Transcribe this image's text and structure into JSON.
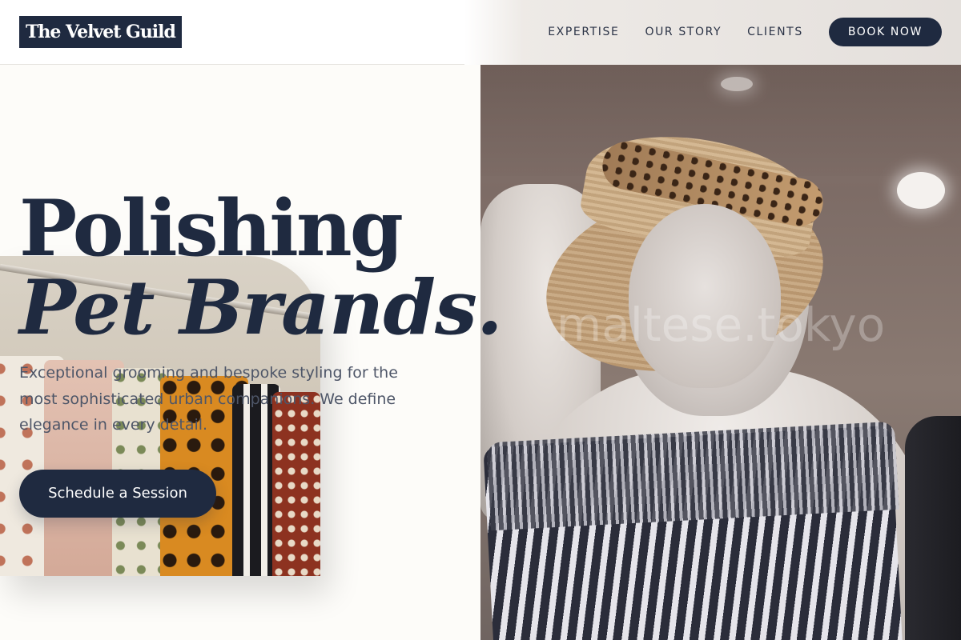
{
  "brand": {
    "logo_text": "The Velvet Guild"
  },
  "nav": {
    "items": [
      {
        "label": "EXPERTISE"
      },
      {
        "label": "OUR STORY"
      },
      {
        "label": "CLIENTS"
      }
    ],
    "book_label": "BOOK NOW"
  },
  "hero": {
    "title_line1": "Polishing",
    "title_line2": "Pet Brands.",
    "description": "Exceptional grooming and bespoke styling for the most sophisticated urban companions. We define elegance in every detail.",
    "cta_label": "Schedule a Session",
    "watermark": "maltese.tokyo"
  },
  "colors": {
    "navy": "#1f2a40",
    "cream": "#fdfcf9",
    "text_muted": "#4e5668"
  }
}
